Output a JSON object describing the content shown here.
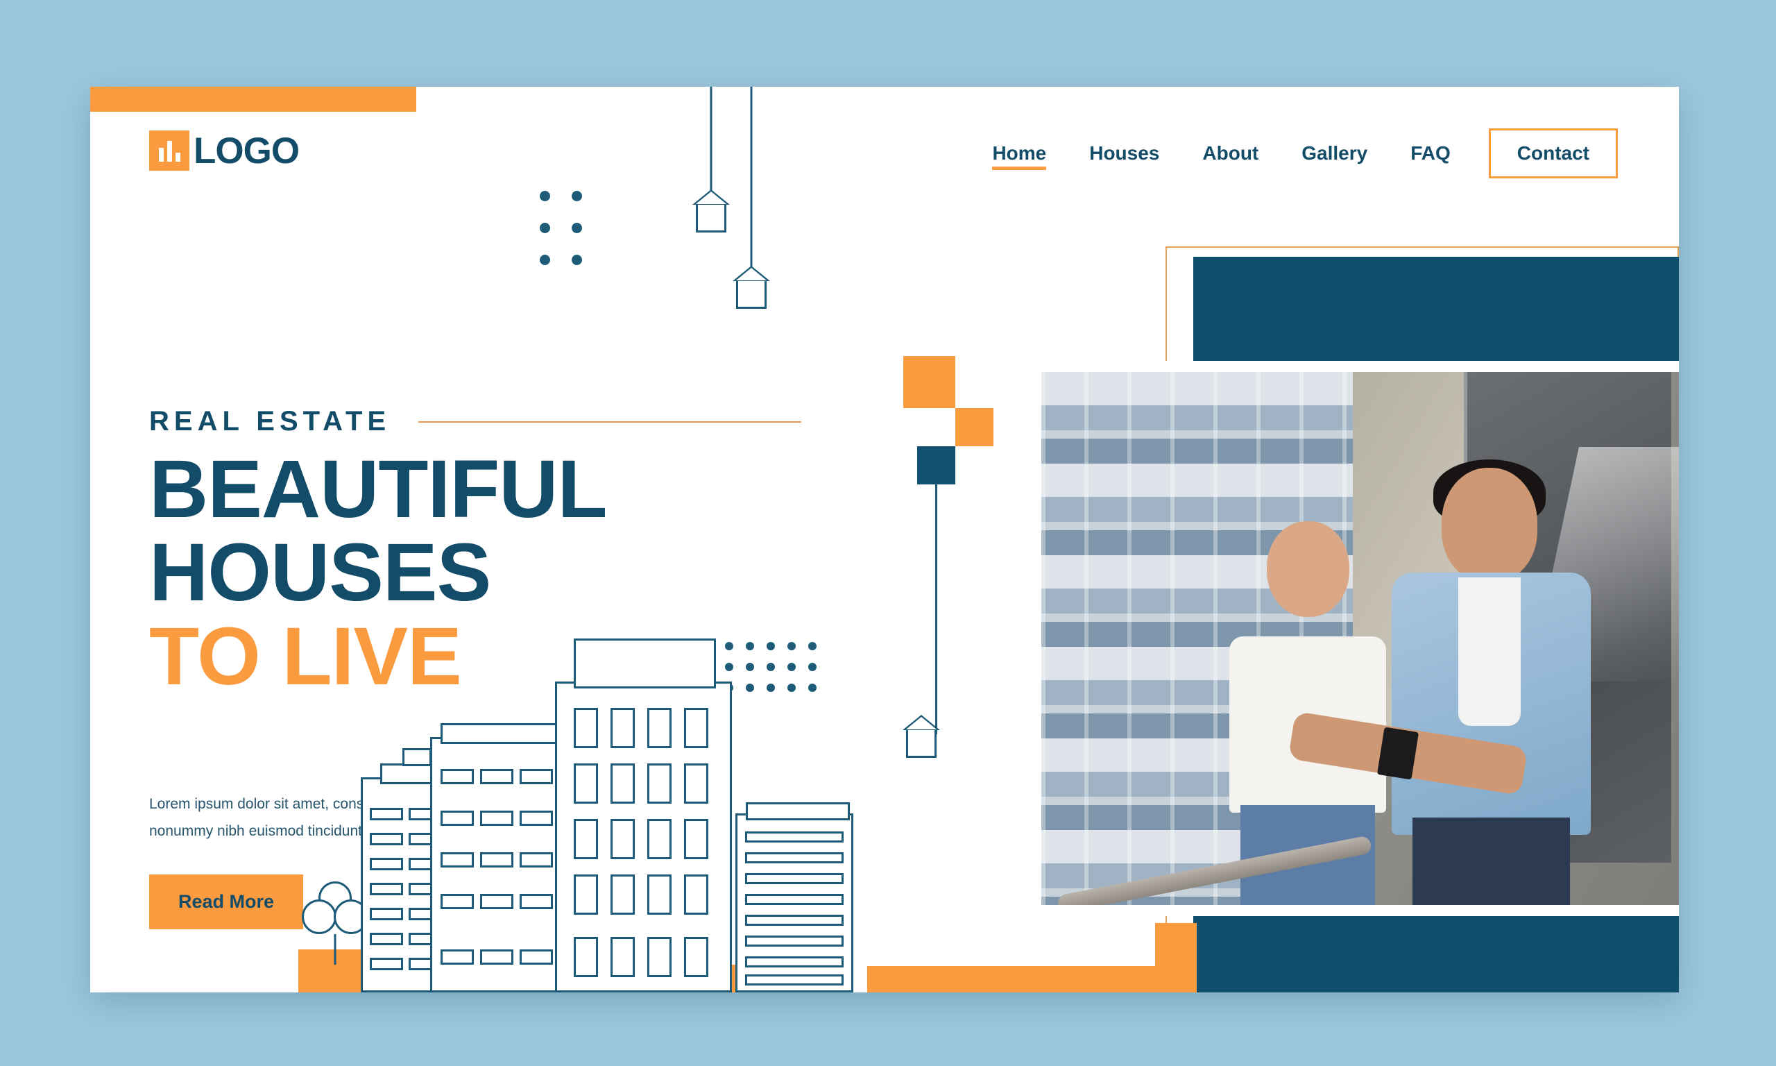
{
  "theme": {
    "navy": "#134c68",
    "panel_navy": "#0f506e",
    "orange": "#f99b3e",
    "page_bg": "#9cc7dc",
    "card_bg": "#ffffff",
    "body_text": "#27556e"
  },
  "header": {
    "logo_text": "LOGO",
    "logo_icon": "bar-chart-icon",
    "nav": [
      {
        "label": "Home",
        "active": true
      },
      {
        "label": "Houses",
        "active": false
      },
      {
        "label": "About",
        "active": false
      },
      {
        "label": "Gallery",
        "active": false
      },
      {
        "label": "FAQ",
        "active": false
      }
    ],
    "cta_label": "Contact"
  },
  "hero": {
    "eyebrow": "REAL ESTATE",
    "headline_line1": "BEAUTIFUL",
    "headline_line2": "HOUSES",
    "headline_line3": "TO LIVE",
    "paragraph": "Lorem ipsum dolor sit amet, consectetuer adipiscing elit, sed diam nonummy nibh euismod tincidunt ut laoreet dolore magna.",
    "button_label": "Read More",
    "carousel": {
      "prev_label": "‹",
      "next_label": "›"
    }
  },
  "media": {
    "photo_alt": "couple embracing on apartment balcony"
  },
  "decor": {
    "hanging_house_icon": "house-outline-icon",
    "tree_icon": "tree-outline-icon",
    "building_icon": "building-outline-icon"
  }
}
